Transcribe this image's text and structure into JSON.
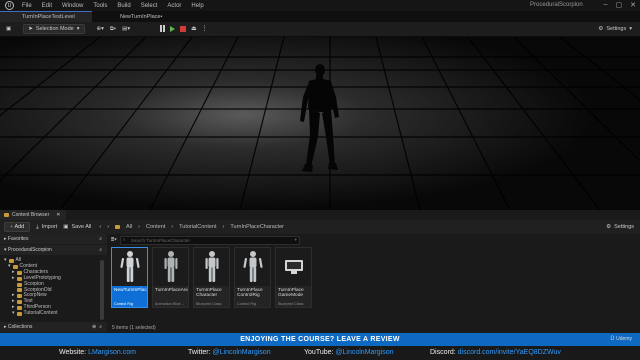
{
  "menubar": {
    "items": [
      "File",
      "Edit",
      "Window",
      "Tools",
      "Build",
      "Select",
      "Actor",
      "Help"
    ],
    "project_name": "ProceduralScorpion"
  },
  "tabs": [
    {
      "label": "TurnInPlaceTestLevel"
    },
    {
      "label": "NewTurnInPlace•"
    }
  ],
  "toolbar": {
    "mode_label": "Selection Mode",
    "settings_label": "Settings"
  },
  "content_browser": {
    "title": "Content Browser",
    "add_label": "Add",
    "import_label": "Import",
    "save_all_label": "Save All",
    "breadcrumb": [
      "All",
      "Content",
      "TutorialContent",
      "TurnInPlaceCharacter"
    ],
    "settings_label": "Settings",
    "favorites_label": "Favorites",
    "project_root": "ProceduralScorpion",
    "search_placeholder": "Search TurnInPlaceCharacter",
    "tree": [
      {
        "label": "All",
        "depth": 0
      },
      {
        "label": "Content",
        "depth": 1
      },
      {
        "label": "Characters",
        "depth": 2
      },
      {
        "label": "LevelPrototyping",
        "depth": 2
      },
      {
        "label": "Scorpion",
        "depth": 2
      },
      {
        "label": "ScorpionOld",
        "depth": 2
      },
      {
        "label": "ScorpNew",
        "depth": 2
      },
      {
        "label": "Test",
        "depth": 2
      },
      {
        "label": "ThirdPerson",
        "depth": 2
      },
      {
        "label": "TutorialContent",
        "depth": 2
      }
    ],
    "collections_label": "Collections",
    "assets": [
      {
        "name": "NewTurnInPlace",
        "type": "Control Rig",
        "selected": true
      },
      {
        "name": "TurnInPlaceAnimBP",
        "type": "Animation Blue...",
        "selected": false
      },
      {
        "name": "TurnInPlace Character",
        "type": "Blueprint Class",
        "selected": false
      },
      {
        "name": "TurnInPlace ControlRig",
        "type": "Control Rig",
        "selected": false
      },
      {
        "name": "TurnInPlace GameMode",
        "type": "Blueprint Class",
        "selected": false
      }
    ],
    "status": "5 items (1 selected)"
  },
  "banner": {
    "text": "ENJOYING THE COURSE? LEAVE A REVIEW"
  },
  "footer": {
    "website_label": "Website:",
    "website_value": "LMargison.com",
    "twitter_label": "Twitter:",
    "twitter_value": "@LincolnMargison",
    "youtube_label": "YouTube:",
    "youtube_value": "@LincolnMargison",
    "discord_label": "Discord:",
    "discord_value": "discord.com/invite/YaEQ8DZWuv",
    "brand": "Udemy"
  },
  "colors": {
    "accent": "#0e6fd6",
    "banner": "#0d69c2",
    "link": "#2f9bff"
  }
}
